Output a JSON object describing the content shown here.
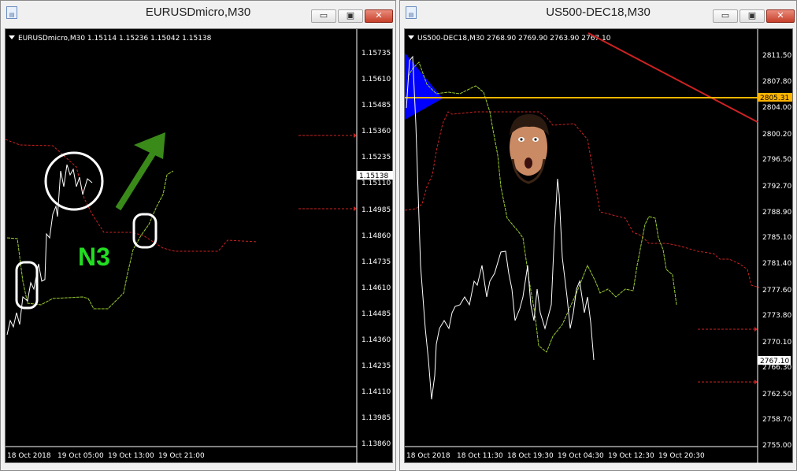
{
  "colors": {
    "ma": "#9acd32",
    "red": "#cc2222",
    "orange": "#ffb400",
    "blue": "#0000ff",
    "green_arrow": "#3a8a1a",
    "n3": "#22dd22"
  },
  "left": {
    "title": "EURUSDmicro,M30",
    "header": "EURUSDmicro,M30  1.15114 1.15236 1.15042 1.15138",
    "price_ticks": [
      "1.15735",
      "1.15610",
      "1.15485",
      "1.15360",
      "1.15235",
      "1.15110",
      "1.14985",
      "1.14860",
      "1.14735",
      "1.14610",
      "1.14485",
      "1.14360",
      "1.14235",
      "1.14110",
      "1.13985",
      "1.13860"
    ],
    "time_ticks": [
      "18 Oct 2018",
      "19 Oct 05:00",
      "19 Oct 13:00",
      "19 Oct 21:00"
    ],
    "current_price": "1.15138",
    "annotation_text": "N3",
    "buttons": {
      "min": "▭",
      "max": "▣",
      "close": "✕"
    },
    "icon_text": "▤"
  },
  "right": {
    "title": "US500-DEC18,M30",
    "header": "US500-DEC18,M30  2768.90 2769.90 2763.90 2767.10",
    "price_ticks": [
      "2811.50",
      "2807.80",
      "2804.00",
      "2800.20",
      "2796.50",
      "2792.70",
      "2788.90",
      "2785.10",
      "2781.40",
      "2777.60",
      "2773.80",
      "2770.10",
      "2766.30",
      "2762.50",
      "2758.70",
      "2755.00"
    ],
    "time_ticks": [
      "18 Oct 2018",
      "18 Oct 11:30",
      "18 Oct 19:30",
      "19 Oct 04:30",
      "19 Oct 12:30",
      "19 Oct 20:30"
    ],
    "current_price": "2767.10",
    "level_price": "2805.31",
    "buttons": {
      "min": "▭",
      "max": "▣",
      "close": "✕"
    },
    "icon_text": "▤"
  }
}
